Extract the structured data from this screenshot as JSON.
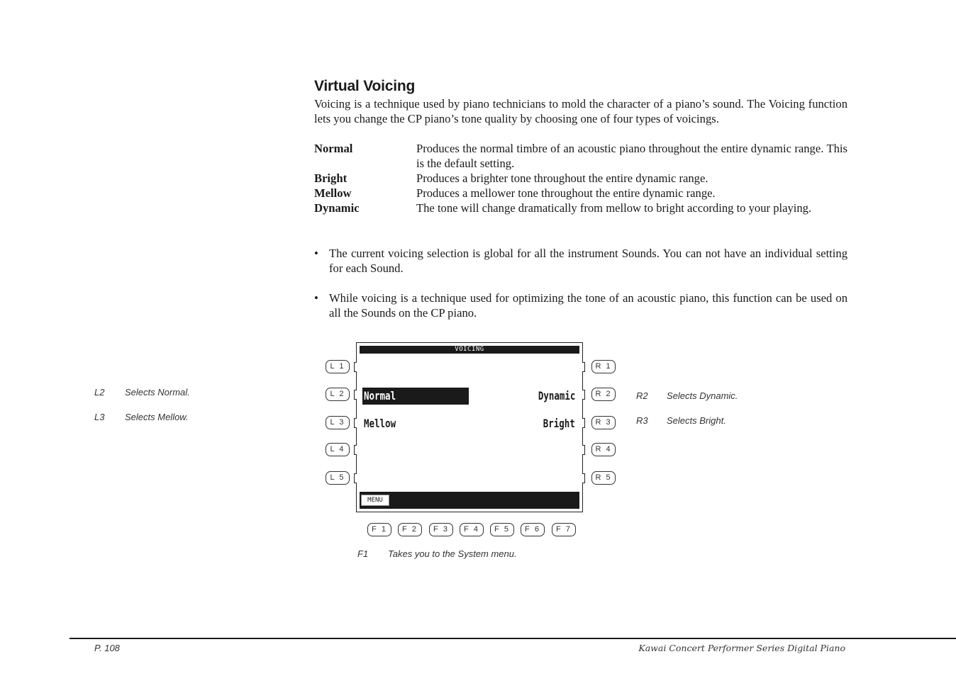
{
  "section": {
    "title": "Virtual Voicing",
    "intro": "Voicing is a technique used by piano technicians to mold the character of a piano’s sound.  The Voicing function lets you change the CP piano’s tone quality by choosing one of four types of voicings."
  },
  "definitions": [
    {
      "term": "Normal",
      "desc": "Produces the normal timbre of an acoustic piano throughout the entire dynamic range.  This is the default setting."
    },
    {
      "term": "Bright",
      "desc": "Produces a brighter tone throughout the entire dynamic range."
    },
    {
      "term": "Mellow",
      "desc": "Produces a mellower tone throughout the entire dynamic range."
    },
    {
      "term": "Dynamic",
      "desc": "The tone will change dramatically from mellow to bright according to your playing."
    }
  ],
  "bullets": [
    "The current voicing selection is global for all the instrument Sounds.  You can not have an individual setting for each Sound.",
    "While voicing is a technique used for optimizing the tone of an acoustic piano, this function can be used on all the Sounds on the CP piano."
  ],
  "bullet_symbol": "•",
  "lcd": {
    "header": "VOICING",
    "items": {
      "normal": "Normal",
      "mellow": "Mellow",
      "dynamic": "Dynamic",
      "bright": "Bright"
    },
    "selected": "Normal",
    "menu_label": "MENU"
  },
  "buttons": {
    "left": [
      "L 1",
      "L 2",
      "L 3",
      "L 4",
      "L 5"
    ],
    "right": [
      "R 1",
      "R 2",
      "R 3",
      "R 4",
      "R 5"
    ],
    "function": [
      "F 1",
      "F 2",
      "F 3",
      "F 4",
      "F 5",
      "F 6",
      "F 7"
    ]
  },
  "annotations": {
    "left": [
      {
        "key": "L2",
        "text": "Selects Normal."
      },
      {
        "key": "L3",
        "text": "Selects Mellow."
      }
    ],
    "right": [
      {
        "key": "R2",
        "text": "Selects Dynamic."
      },
      {
        "key": "R3",
        "text": "Selects Bright."
      }
    ],
    "bottom": [
      {
        "key": "F1",
        "text": "Takes you to the System menu."
      }
    ]
  },
  "footer": {
    "page": "P. 108",
    "title": "Kawai Concert Performer Series Digital Piano"
  }
}
